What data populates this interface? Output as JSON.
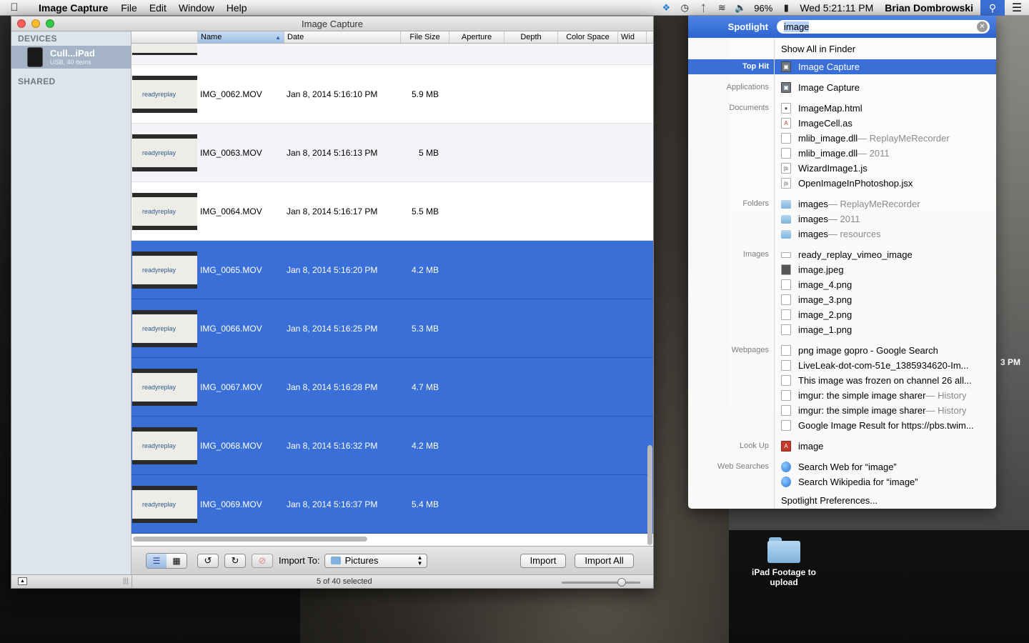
{
  "menubar": {
    "app_name": "Image Capture",
    "menus": [
      "File",
      "Edit",
      "Window",
      "Help"
    ],
    "battery": "96%",
    "clock": "Wed 5:21:11 PM",
    "user": "Brian Dombrowski"
  },
  "window": {
    "title": "Image Capture",
    "sidebar": {
      "devices_header": "DEVICES",
      "device_name": "Cull...iPad",
      "device_sub": "USB, 40 items",
      "shared_header": "SHARED"
    },
    "columns": [
      "Name",
      "Date",
      "File Size",
      "Aperture",
      "Depth",
      "Color Space",
      "Wid"
    ],
    "thumb_logo": "readyreplay",
    "rows": [
      {
        "name": "IMG_0062.MOV",
        "date": "Jan 8, 2014 5:16:10 PM",
        "size": "5.9 MB"
      },
      {
        "name": "IMG_0063.MOV",
        "date": "Jan 8, 2014 5:16:13 PM",
        "size": "5 MB"
      },
      {
        "name": "IMG_0064.MOV",
        "date": "Jan 8, 2014 5:16:17 PM",
        "size": "5.5 MB"
      },
      {
        "name": "IMG_0065.MOV",
        "date": "Jan 8, 2014 5:16:20 PM",
        "size": "4.2 MB"
      },
      {
        "name": "IMG_0066.MOV",
        "date": "Jan 8, 2014 5:16:25 PM",
        "size": "5.3 MB"
      },
      {
        "name": "IMG_0067.MOV",
        "date": "Jan 8, 2014 5:16:28 PM",
        "size": "4.7 MB"
      },
      {
        "name": "IMG_0068.MOV",
        "date": "Jan 8, 2014 5:16:32 PM",
        "size": "4.2 MB"
      },
      {
        "name": "IMG_0069.MOV",
        "date": "Jan 8, 2014 5:16:37 PM",
        "size": "5.4 MB"
      }
    ],
    "toolbar": {
      "import_to_label": "Import To:",
      "destination": "Pictures",
      "import_label": "Import",
      "import_all_label": "Import All"
    },
    "status": "5 of 40 selected"
  },
  "spotlight": {
    "title": "Spotlight",
    "query": "image",
    "show_all": "Show All in Finder",
    "top_hit_label": "Top Hit",
    "top_hit": "Image Capture",
    "categories": {
      "applications": "Applications",
      "documents": "Documents",
      "folders": "Folders",
      "images": "Images",
      "webpages": "Webpages",
      "lookup": "Look Up",
      "websearches": "Web Searches"
    },
    "applications": [
      "Image Capture"
    ],
    "documents": [
      {
        "name": "ImageMap.html",
        "sub": ""
      },
      {
        "name": "ImageCell.as",
        "sub": ""
      },
      {
        "name": "mlib_image.dll",
        "sub": " — ReplayMeRecorder"
      },
      {
        "name": "mlib_image.dll",
        "sub": " — 2011"
      },
      {
        "name": "WizardImage1.js",
        "sub": ""
      },
      {
        "name": "OpenImageInPhotoshop.jsx",
        "sub": ""
      }
    ],
    "folders": [
      {
        "name": "images",
        "sub": " — ReplayMeRecorder"
      },
      {
        "name": "images",
        "sub": " — 2011"
      },
      {
        "name": "images",
        "sub": " — resources"
      }
    ],
    "images": [
      "ready_replay_vimeo_image",
      "image.jpeg",
      "image_4.png",
      "image_3.png",
      "image_2.png",
      "image_1.png"
    ],
    "webpages": [
      {
        "name": "png image gopro - Google Search",
        "sub": ""
      },
      {
        "name": "LiveLeak-dot-com-51e_1385934620-Im...",
        "sub": ""
      },
      {
        "name": "This image was frozen on channel 26 all...",
        "sub": ""
      },
      {
        "name": "imgur: the simple image sharer",
        "sub": " — History"
      },
      {
        "name": "imgur: the simple image sharer",
        "sub": " — History"
      },
      {
        "name": "Google Image Result for https://pbs.twim...",
        "sub": ""
      }
    ],
    "lookup": "image",
    "websearches": [
      "Search Web for “image”",
      "Search Wikipedia for “image”"
    ],
    "preferences": "Spotlight Preferences..."
  },
  "desktop": {
    "folder_label": "iPad Footage to upload",
    "clock_fragment": "3 PM"
  }
}
